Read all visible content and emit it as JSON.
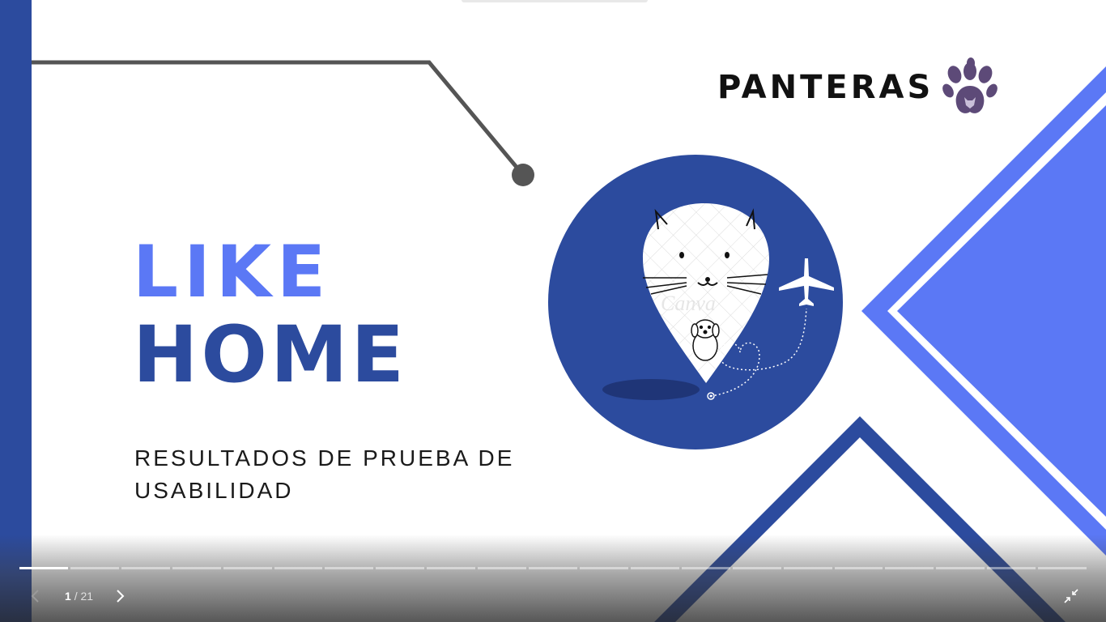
{
  "slide": {
    "brand": {
      "name": "PANTERAS",
      "logo_icon": "paw-print-icon"
    },
    "title": {
      "line1": "LIKE",
      "line2": "HOME"
    },
    "subtitle": {
      "line1": "RESULTADOS DE PRUEBA DE",
      "line2": "USABILIDAD"
    },
    "illustration": {
      "icons": [
        "cat-location-pin-icon",
        "dog-icon",
        "airplane-icon",
        "heart-path-icon"
      ],
      "watermark": "Canva"
    },
    "colors": {
      "primary": "#2c4b9e",
      "accent": "#5b78f5",
      "connector": "#555555",
      "paw": "#5d4a78"
    }
  },
  "player": {
    "current_slide": "1",
    "separator": "/",
    "total_slides": "21",
    "progress_fraction": 0.0476,
    "icons": {
      "prev": "chevron-left-icon",
      "next": "chevron-right-icon",
      "exit": "exit-fullscreen-icon"
    }
  }
}
